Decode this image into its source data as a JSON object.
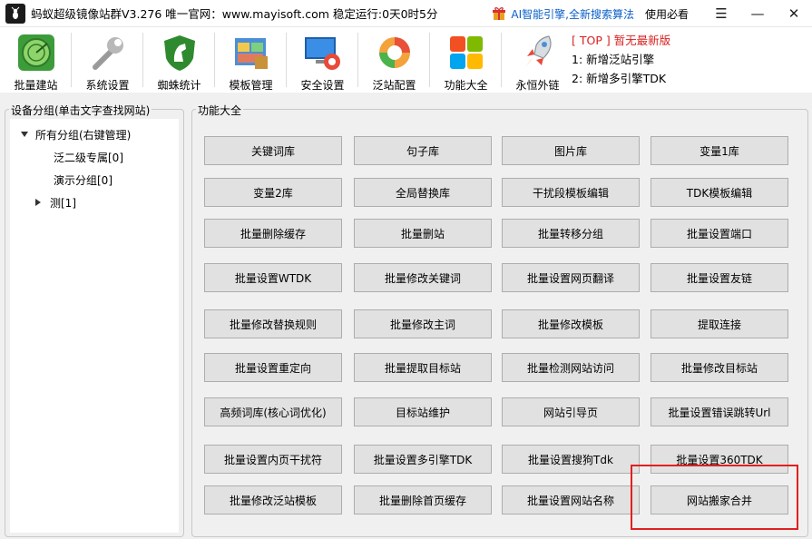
{
  "window": {
    "title": "蚂蚁超级镜像站群V3.276 唯一官网：www.mayisoft.com 稳定运行:0天0时5分",
    "ai_link": "AI智能引擎,全新搜索算法",
    "help": "使用必看",
    "menu_glyph": "☰",
    "minimize_glyph": "—",
    "close_glyph": "✕"
  },
  "toolbar": {
    "items": [
      {
        "label": "批量建站",
        "icon": "radar-icon"
      },
      {
        "label": "系统设置",
        "icon": "wrench-icon"
      },
      {
        "label": "蜘蛛统计",
        "icon": "horse-shield-icon"
      },
      {
        "label": "模板管理",
        "icon": "template-icon"
      },
      {
        "label": "安全设置",
        "icon": "monitor-lifebuoy-icon"
      },
      {
        "label": "泛站配置",
        "icon": "refresh-globe-icon"
      },
      {
        "label": "功能大全",
        "icon": "tiles-icon"
      },
      {
        "label": "永恒外链",
        "icon": "rocket-icon"
      }
    ]
  },
  "news": {
    "top_line": "[ TOP ] 暂无最新版",
    "line1": "1:  新增泛站引擎",
    "line2": "2:  新增多引擎TDK"
  },
  "groups": {
    "title": "设备分组(单击文字查找网站)",
    "root": "所有分组(右键管理)",
    "items": [
      "泛二级专属[0]",
      "演示分组[0]",
      "测[1]"
    ]
  },
  "functions": {
    "title": "功能大全",
    "buttons": [
      "关键词库",
      "句子库",
      "图片库",
      "变量1库",
      "变量2库",
      "全局替换库",
      "干扰段模板编辑",
      "TDK模板编辑",
      "批量删除缓存",
      "批量删站",
      "批量转移分组",
      "批量设置端口",
      "批量设置WTDK",
      "批量修改关键词",
      "批量设置网页翻译",
      "批量设置友链",
      "批量修改替换规则",
      "批量修改主词",
      "批量修改模板",
      "提取连接",
      "批量设置重定向",
      "批量提取目标站",
      "批量检测网站访问",
      "批量修改目标站",
      "高频词库(核心词优化)",
      "目标站维护",
      "网站引导页",
      "批量设置错误跳转Url",
      "批量设置内页干扰符",
      "批量设置多引擎TDK",
      "批量设置搜狗Tdk",
      "批量设置360TDK",
      "批量修改泛站模板",
      "批量删除首页缓存",
      "批量设置网站名称",
      "网站搬家合并"
    ]
  },
  "colors": {
    "ai_blue": "#0a60c8",
    "top_red": "#d82020",
    "highlight_red": "#e02020"
  }
}
